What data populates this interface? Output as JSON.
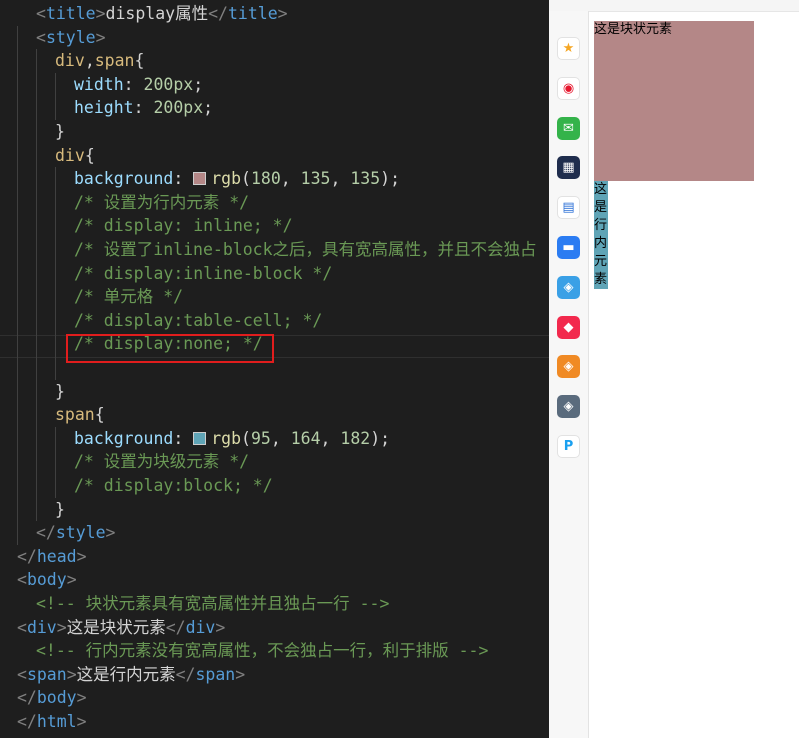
{
  "editor": {
    "lines": [
      {
        "indent": 36,
        "tokens": [
          {
            "t": "<",
            "c": "punc"
          },
          {
            "t": "title",
            "c": "tag"
          },
          {
            "t": ">",
            "c": "punc"
          },
          {
            "t": "display属性",
            "c": "txt"
          },
          {
            "t": "</",
            "c": "punc"
          },
          {
            "t": "title",
            "c": "tag"
          },
          {
            "t": ">",
            "c": "punc"
          }
        ]
      },
      {
        "indent": 36,
        "tokens": [
          {
            "t": "<",
            "c": "punc"
          },
          {
            "t": "style",
            "c": "tag"
          },
          {
            "t": ">",
            "c": "punc"
          }
        ]
      },
      {
        "indent": 55,
        "tokens": [
          {
            "t": "div",
            "c": "sel"
          },
          {
            "t": ",",
            "c": "txt"
          },
          {
            "t": "span",
            "c": "sel"
          },
          {
            "t": "{",
            "c": "txt"
          }
        ]
      },
      {
        "indent": 74,
        "tokens": [
          {
            "t": "width",
            "c": "prop"
          },
          {
            "t": ": ",
            "c": "txt"
          },
          {
            "t": "200px",
            "c": "num"
          },
          {
            "t": ";",
            "c": "txt"
          }
        ]
      },
      {
        "indent": 74,
        "tokens": [
          {
            "t": "height",
            "c": "prop"
          },
          {
            "t": ": ",
            "c": "txt"
          },
          {
            "t": "200px",
            "c": "num"
          },
          {
            "t": ";",
            "c": "txt"
          }
        ]
      },
      {
        "indent": 55,
        "tokens": [
          {
            "t": "}",
            "c": "txt"
          }
        ]
      },
      {
        "indent": 55,
        "tokens": [
          {
            "t": "div",
            "c": "sel"
          },
          {
            "t": "{",
            "c": "txt"
          }
        ]
      },
      {
        "indent": 74,
        "tokens": [
          {
            "t": "background",
            "c": "prop"
          },
          {
            "t": ": ",
            "c": "txt"
          },
          {
            "swatch": "#b48787"
          },
          {
            "t": "rgb",
            "c": "fn"
          },
          {
            "t": "(",
            "c": "txt"
          },
          {
            "t": "180",
            "c": "num"
          },
          {
            "t": ", ",
            "c": "txt"
          },
          {
            "t": "135",
            "c": "num"
          },
          {
            "t": ", ",
            "c": "txt"
          },
          {
            "t": "135",
            "c": "num"
          },
          {
            "t": ");",
            "c": "txt"
          }
        ]
      },
      {
        "indent": 74,
        "tokens": [
          {
            "t": "/* 设置为行内元素 */",
            "c": "com"
          }
        ]
      },
      {
        "indent": 74,
        "tokens": [
          {
            "t": "/* display: inline; */",
            "c": "com"
          }
        ]
      },
      {
        "indent": 74,
        "tokens": [
          {
            "t": "/* 设置了inline-block之后，具有宽高属性，并且不会独占",
            "c": "com"
          }
        ]
      },
      {
        "indent": 74,
        "tokens": [
          {
            "t": "/* display:inline-block */",
            "c": "com"
          }
        ]
      },
      {
        "indent": 74,
        "tokens": [
          {
            "t": "/* 单元格 */",
            "c": "com"
          }
        ]
      },
      {
        "indent": 74,
        "tokens": [
          {
            "t": "/* display:table-cell; */",
            "c": "com"
          }
        ]
      },
      {
        "indent": 74,
        "tokens": [
          {
            "t": "/* display:none; */",
            "c": "com"
          }
        ]
      },
      {
        "indent": 0,
        "tokens": []
      },
      {
        "indent": 55,
        "tokens": [
          {
            "t": "}",
            "c": "txt"
          }
        ]
      },
      {
        "indent": 55,
        "tokens": [
          {
            "t": "span",
            "c": "sel"
          },
          {
            "t": "{",
            "c": "txt"
          }
        ]
      },
      {
        "indent": 74,
        "tokens": [
          {
            "t": "background",
            "c": "prop"
          },
          {
            "t": ": ",
            "c": "txt"
          },
          {
            "swatch": "#5fa4b6"
          },
          {
            "t": "rgb",
            "c": "fn"
          },
          {
            "t": "(",
            "c": "txt"
          },
          {
            "t": "95",
            "c": "num"
          },
          {
            "t": ", ",
            "c": "txt"
          },
          {
            "t": "164",
            "c": "num"
          },
          {
            "t": ", ",
            "c": "txt"
          },
          {
            "t": "182",
            "c": "num"
          },
          {
            "t": ");",
            "c": "txt"
          }
        ]
      },
      {
        "indent": 74,
        "tokens": [
          {
            "t": "/* 设置为块级元素 */",
            "c": "com"
          }
        ]
      },
      {
        "indent": 74,
        "tokens": [
          {
            "t": "/* display:block; */",
            "c": "com"
          }
        ]
      },
      {
        "indent": 55,
        "tokens": [
          {
            "t": "}",
            "c": "txt"
          }
        ]
      },
      {
        "indent": 36,
        "tokens": [
          {
            "t": "</",
            "c": "punc"
          },
          {
            "t": "style",
            "c": "tag"
          },
          {
            "t": ">",
            "c": "punc"
          }
        ]
      },
      {
        "indent": 17,
        "tokens": [
          {
            "t": "</",
            "c": "punc"
          },
          {
            "t": "head",
            "c": "tag"
          },
          {
            "t": ">",
            "c": "punc"
          }
        ]
      },
      {
        "indent": 17,
        "tokens": [
          {
            "t": "<",
            "c": "punc"
          },
          {
            "t": "body",
            "c": "tag"
          },
          {
            "t": ">",
            "c": "punc"
          }
        ]
      },
      {
        "indent": 36,
        "tokens": [
          {
            "t": "<!-- 块状元素具有宽高属性并且独占一行 -->",
            "c": "com"
          }
        ]
      },
      {
        "indent": 17,
        "tokens": [
          {
            "t": "<",
            "c": "punc"
          },
          {
            "t": "div",
            "c": "tag"
          },
          {
            "t": ">",
            "c": "punc"
          },
          {
            "t": "这是块状元素",
            "c": "txt"
          },
          {
            "t": "</",
            "c": "punc"
          },
          {
            "t": "div",
            "c": "tag"
          },
          {
            "t": ">",
            "c": "punc"
          }
        ]
      },
      {
        "indent": 36,
        "tokens": [
          {
            "t": "<!-- 行内元素没有宽高属性，不会独占一行，利于排版 -->",
            "c": "com"
          }
        ]
      },
      {
        "indent": 17,
        "tokens": [
          {
            "t": "<",
            "c": "punc"
          },
          {
            "t": "span",
            "c": "tag"
          },
          {
            "t": ">",
            "c": "punc"
          },
          {
            "t": "这是行内元素",
            "c": "txt"
          },
          {
            "t": "</",
            "c": "punc"
          },
          {
            "t": "span",
            "c": "tag"
          },
          {
            "t": ">",
            "c": "punc"
          }
        ]
      },
      {
        "indent": 17,
        "tokens": [
          {
            "t": "</",
            "c": "punc"
          },
          {
            "t": "body",
            "c": "tag"
          },
          {
            "t": ">",
            "c": "punc"
          }
        ]
      },
      {
        "indent": 17,
        "tokens": [
          {
            "t": "</",
            "c": "punc"
          },
          {
            "t": "html",
            "c": "tag"
          },
          {
            "t": ">",
            "c": "punc"
          }
        ]
      }
    ]
  },
  "browser": {
    "sidebar_icons": [
      {
        "name": "favorites-star-icon",
        "bg": "#ffffff",
        "fg": "#f5a623",
        "glyph": "★"
      },
      {
        "name": "weibo-icon",
        "bg": "#ffffff",
        "fg": "#e6162d",
        "glyph": "◉"
      },
      {
        "name": "mail-icon",
        "bg": "#34b34a",
        "fg": "#ffffff",
        "glyph": "✉"
      },
      {
        "name": "news-app-icon",
        "bg": "#1f2d4d",
        "fg": "#ffffff",
        "glyph": "▦"
      },
      {
        "name": "document-icon",
        "bg": "#ffffff",
        "fg": "#2b6fd6",
        "glyph": "▤"
      },
      {
        "name": "chat-bubble-icon",
        "bg": "#2b7cf2",
        "fg": "#ffffff",
        "glyph": "▬"
      },
      {
        "name": "game-app-icon-1",
        "bg": "#3aa0e6",
        "fg": "#ffffff",
        "glyph": "◈"
      },
      {
        "name": "mini-program-icon",
        "bg": "#f2294d",
        "fg": "#ffffff",
        "glyph": "◆"
      },
      {
        "name": "game-app-icon-2",
        "bg": "#f08a24",
        "fg": "#ffffff",
        "glyph": "◈"
      },
      {
        "name": "game-app-icon-3",
        "bg": "#5a6b7d",
        "fg": "#ffffff",
        "glyph": "◈"
      },
      {
        "name": "app-p-icon",
        "bg": "#ffffff",
        "fg": "#1aa0f0",
        "glyph": "P"
      }
    ],
    "demo": {
      "div_text": "这是块状元素",
      "span_text": "这是行内元素",
      "div_color": "#b48787",
      "span_color": "#5fa4b6"
    }
  }
}
